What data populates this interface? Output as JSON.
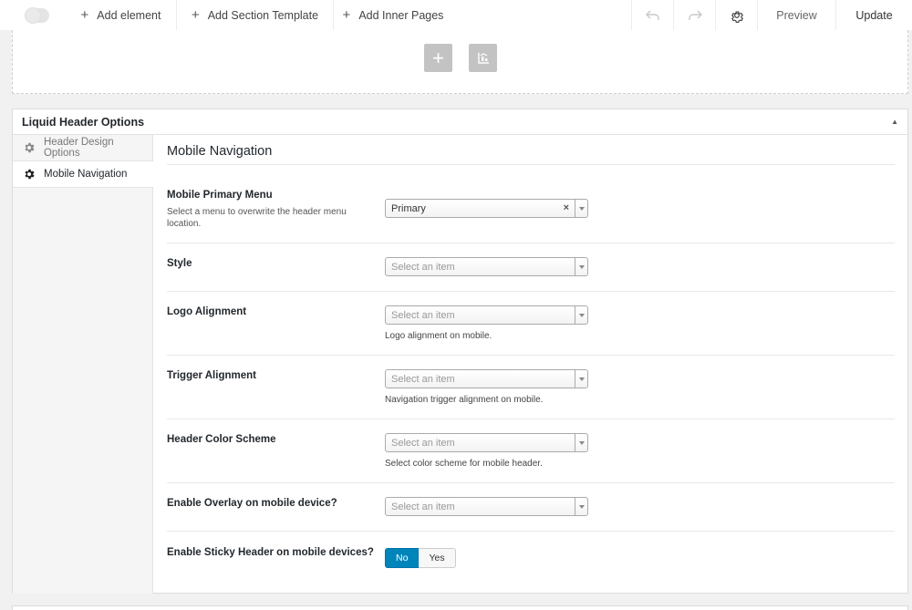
{
  "toolbar": {
    "add_element": "Add element",
    "add_section_template": "Add Section Template",
    "add_inner_pages": "Add Inner Pages",
    "preview": "Preview",
    "update": "Update"
  },
  "panel": {
    "title": "Liquid Header Options"
  },
  "sidebar": {
    "items": [
      {
        "label": "Header Design Options",
        "icon": "gear-icon"
      },
      {
        "label": "Mobile Navigation",
        "icon": "gear-icon"
      }
    ]
  },
  "content": {
    "section_title": "Mobile Navigation",
    "fields": [
      {
        "label": "Mobile Primary Menu",
        "description": "Select a menu to overwrite the header menu location.",
        "value": "Primary"
      },
      {
        "label": "Style",
        "placeholder": "Select an item"
      },
      {
        "label": "Logo Alignment",
        "placeholder": "Select an item",
        "help": "Logo alignment on mobile."
      },
      {
        "label": "Trigger Alignment",
        "placeholder": "Select an item",
        "help": "Navigation trigger alignment on mobile."
      },
      {
        "label": "Header Color Scheme",
        "placeholder": "Select an item",
        "help": "Select color scheme for mobile header."
      },
      {
        "label": "Enable Overlay on mobile device?",
        "placeholder": "Select an item"
      },
      {
        "label": "Enable Sticky Header on mobile devices?",
        "options": [
          "No",
          "Yes"
        ],
        "selected": "No"
      }
    ]
  },
  "colors": {
    "accent": "#0085ba",
    "background": "#f1f1f1"
  }
}
